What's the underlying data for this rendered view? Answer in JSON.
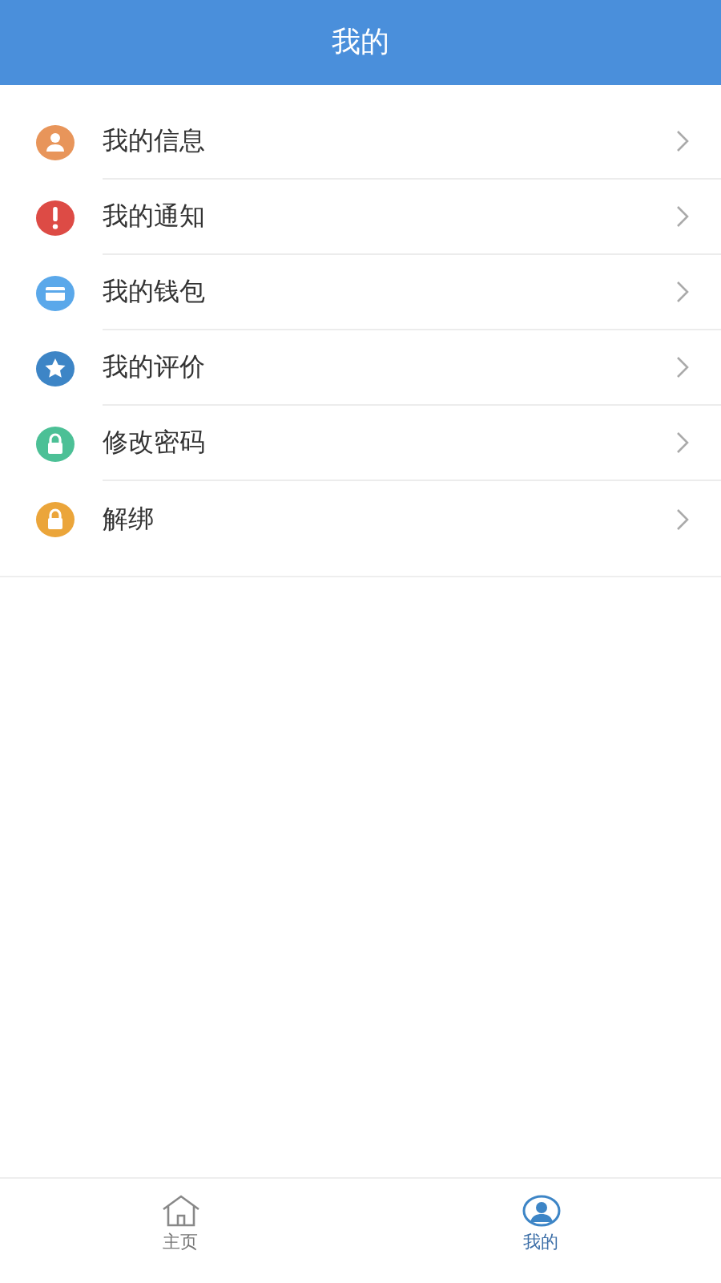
{
  "header": {
    "title": "我的"
  },
  "menu": [
    {
      "label": "我的信息",
      "kind": "person",
      "color": "#e8955a"
    },
    {
      "label": "我的通知",
      "kind": "alert",
      "color": "#dd4b45"
    },
    {
      "label": "我的钱包",
      "kind": "card",
      "color": "#5aa8ea"
    },
    {
      "label": "我的评价",
      "kind": "star",
      "color": "#3d85c6"
    },
    {
      "label": "修改密码",
      "kind": "lock",
      "color": "#4cc096"
    },
    {
      "label": "解绑",
      "kind": "lock",
      "color": "#eba53a"
    }
  ],
  "tab_bar": [
    {
      "label": "主页",
      "kind": "home",
      "selected": false
    },
    {
      "label": "我的",
      "kind": "user",
      "selected": true
    }
  ]
}
